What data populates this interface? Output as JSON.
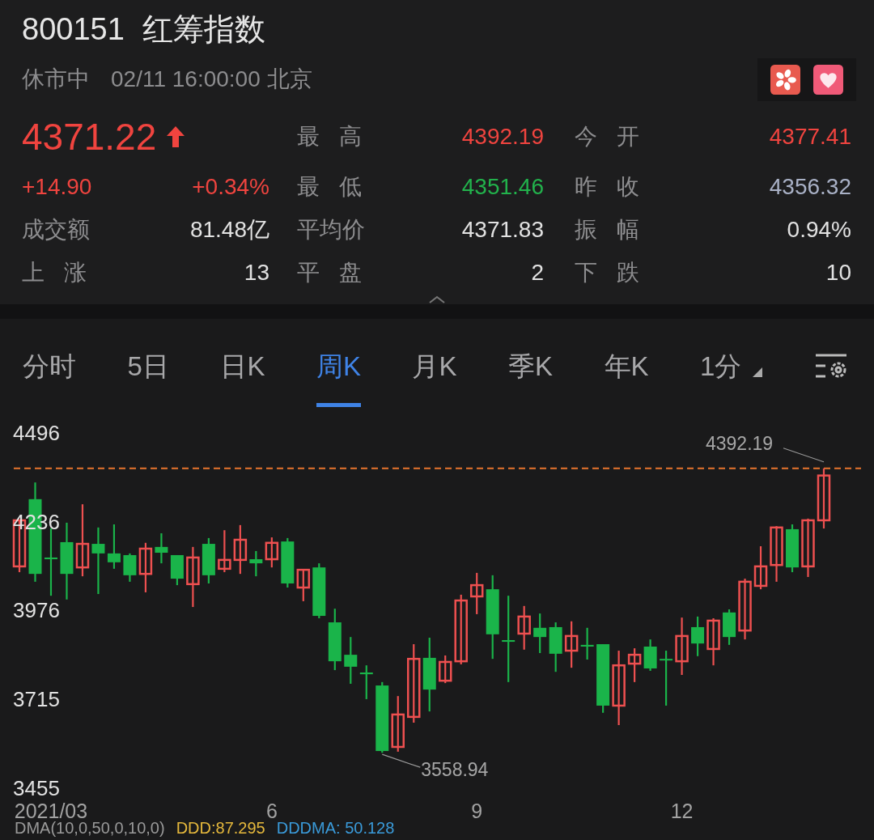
{
  "header": {
    "code": "800151",
    "name": "红筹指数",
    "status": "休市中",
    "time": "02/11 16:00:00 北京"
  },
  "quote": {
    "price": "4371.22",
    "color": "#f0443f",
    "change": "+14.90",
    "change_pct": "+0.34%",
    "stats": [
      {
        "label": "最高",
        "value": "4392.19",
        "color": "#f0443f"
      },
      {
        "label": "今开",
        "value": "4377.41",
        "color": "#f0443f"
      },
      {
        "label": "最低",
        "value": "4351.46",
        "color": "#22b24c"
      },
      {
        "label": "昨收",
        "value": "4356.32",
        "color": "#a9b1c6"
      },
      {
        "label": "平均价",
        "value": "4371.83",
        "color": "#e2e2e2"
      },
      {
        "label": "振幅",
        "value": "0.94%",
        "color": "#e2e2e2"
      }
    ],
    "left_stats": [
      {
        "label": "成交额",
        "value": "81.48亿"
      },
      {
        "label": "上涨",
        "value": "13"
      }
    ],
    "row4": [
      {
        "label": "平盘",
        "value": "2",
        "color": "#e2e2e2"
      },
      {
        "label": "下跌",
        "value": "10",
        "color": "#e2e2e2"
      }
    ]
  },
  "tabs": [
    {
      "label": "分时",
      "selected": false
    },
    {
      "label": "5日",
      "selected": false
    },
    {
      "label": "日K",
      "selected": false
    },
    {
      "label": "周K",
      "selected": true
    },
    {
      "label": "月K",
      "selected": false
    },
    {
      "label": "季K",
      "selected": false
    },
    {
      "label": "年K",
      "selected": false
    },
    {
      "label": "1分",
      "selected": false,
      "kind": "dropdown"
    }
  ],
  "chart": {
    "high_label": "4392.19",
    "low_label": "3558.94",
    "chart_data": {
      "type": "candlestick",
      "categories": [
        null,
        null,
        "2021/03",
        null,
        null,
        null,
        null,
        null,
        null,
        null,
        null,
        null,
        null,
        null,
        null,
        null,
        "6",
        null,
        null,
        null,
        null,
        null,
        null,
        null,
        null,
        null,
        null,
        null,
        null,
        "9",
        null,
        null,
        null,
        null,
        null,
        null,
        null,
        null,
        null,
        null,
        null,
        null,
        "12",
        null,
        null,
        null,
        null,
        null,
        null,
        null,
        null,
        null
      ],
      "ohlc": [
        [
          4105,
          4240,
          4088,
          4240
        ],
        [
          4302,
          4351,
          4060,
          4083
        ],
        [
          4131,
          4216,
          4019,
          4126
        ],
        [
          4176,
          4233,
          4008,
          4083
        ],
        [
          4102,
          4287,
          4076,
          4171
        ],
        [
          4171,
          4219,
          4024,
          4143
        ],
        [
          4143,
          4228,
          4098,
          4117
        ],
        [
          4138,
          4143,
          4060,
          4079
        ],
        [
          4083,
          4174,
          4029,
          4157
        ],
        [
          4162,
          4202,
          4114,
          4145
        ],
        [
          4138,
          4138,
          4050,
          4069
        ],
        [
          4053,
          4162,
          3986,
          4131
        ],
        [
          4171,
          4188,
          4055,
          4079
        ],
        [
          4098,
          4211,
          4088,
          4124
        ],
        [
          4124,
          4226,
          4083,
          4183
        ],
        [
          4126,
          4150,
          4076,
          4114
        ],
        [
          4126,
          4190,
          4102,
          4174
        ],
        [
          4178,
          4188,
          4043,
          4055
        ],
        [
          4043,
          4095,
          4003,
          4095
        ],
        [
          4102,
          4114,
          3953,
          3960
        ],
        [
          3941,
          3981,
          3801,
          3827
        ],
        [
          3846,
          3898,
          3761,
          3811
        ],
        [
          3794,
          3815,
          3716,
          3789
        ],
        [
          3756,
          3766,
          3558.94,
          3564
        ],
        [
          3576,
          3725,
          3562,
          3671
        ],
        [
          3664,
          3877,
          3647,
          3834
        ],
        [
          3837,
          3896,
          3680,
          3744
        ],
        [
          3770,
          3844,
          3763,
          3825
        ],
        [
          3827,
          4022,
          3818,
          4005
        ],
        [
          4017,
          4086,
          3965,
          4050
        ],
        [
          4038,
          4079,
          3834,
          3906
        ],
        [
          3889,
          4019,
          3766,
          3884
        ],
        [
          3908,
          3989,
          3861,
          3958
        ],
        [
          3925,
          3967,
          3851,
          3898
        ],
        [
          3927,
          3941,
          3796,
          3849
        ],
        [
          3858,
          3944,
          3808,
          3901
        ],
        [
          3875,
          3925,
          3832,
          3870
        ],
        [
          3877,
          3877,
          3676,
          3697
        ],
        [
          3697,
          3858,
          3640,
          3815
        ],
        [
          3820,
          3865,
          3766,
          3846
        ],
        [
          3870,
          3891,
          3799,
          3806
        ],
        [
          3834,
          3858,
          3697,
          3830
        ],
        [
          3827,
          3955,
          3787,
          3901
        ],
        [
          3927,
          3958,
          3842,
          3879
        ],
        [
          3863,
          3953,
          3815,
          3946
        ],
        [
          3970,
          3979,
          3875,
          3898
        ],
        [
          3917,
          4069,
          3891,
          4060
        ],
        [
          4048,
          4164,
          4038,
          4105
        ],
        [
          4109,
          4223,
          4060,
          4219
        ],
        [
          4214,
          4228,
          4088,
          4102
        ],
        [
          4105,
          4245,
          4074,
          4240
        ],
        [
          4240,
          4392.19,
          4216,
          4371.22
        ]
      ],
      "ref_lines": [
        {
          "axis": "y",
          "value": 4392.19,
          "color": "#e8742e"
        }
      ],
      "ylim": [
        3455,
        4496
      ],
      "yticks": [
        3455,
        3715,
        3976,
        4236,
        4496
      ]
    }
  },
  "indicator": {
    "name": "DMA(10,0,50,0,10,0)",
    "values": [
      {
        "text": "DDD:87.295",
        "color": "#e5b83c"
      },
      {
        "text": "DDDMA: 50.128",
        "color": "#3a9ad9"
      }
    ]
  }
}
